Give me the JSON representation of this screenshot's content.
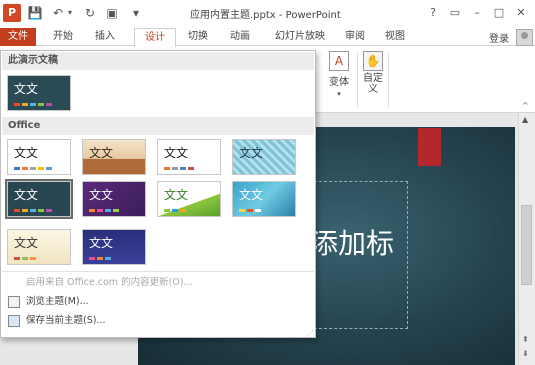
{
  "titlebar": {
    "title": "应用内置主题.pptx - PowerPoint",
    "logo_text": "P",
    "help_label": "?",
    "min_label": "–",
    "restore_label": "□",
    "close_label": "✕"
  },
  "quick_access": {
    "save_icon": "💾",
    "undo_icon": "↶",
    "redo_icon": "↻",
    "slideshow_icon": "▣",
    "customize_icon": "▾"
  },
  "tabs": [
    "文件",
    "开始",
    "插入",
    "设计",
    "切换",
    "动画",
    "幻灯片放映",
    "审阅",
    "视图"
  ],
  "login_label": "登录",
  "ribbon": {
    "variant_label": "变体",
    "customize_label": "自定义",
    "variant_arrow": "▾"
  },
  "gallery": {
    "section_this": "此演示文稿",
    "section_office": "Office",
    "sample_text": "文文",
    "menu_enable": "启用来自 Office.com 的内容更新(O)...",
    "menu_browse": "浏览主题(M)...",
    "menu_save": "保存当前主题(S)..."
  },
  "slide": {
    "title_text": "添加标"
  },
  "colors": {
    "accent": "#c43e1c",
    "slide_bg": "#213c48",
    "slide_ribbon": "#b3282d"
  }
}
